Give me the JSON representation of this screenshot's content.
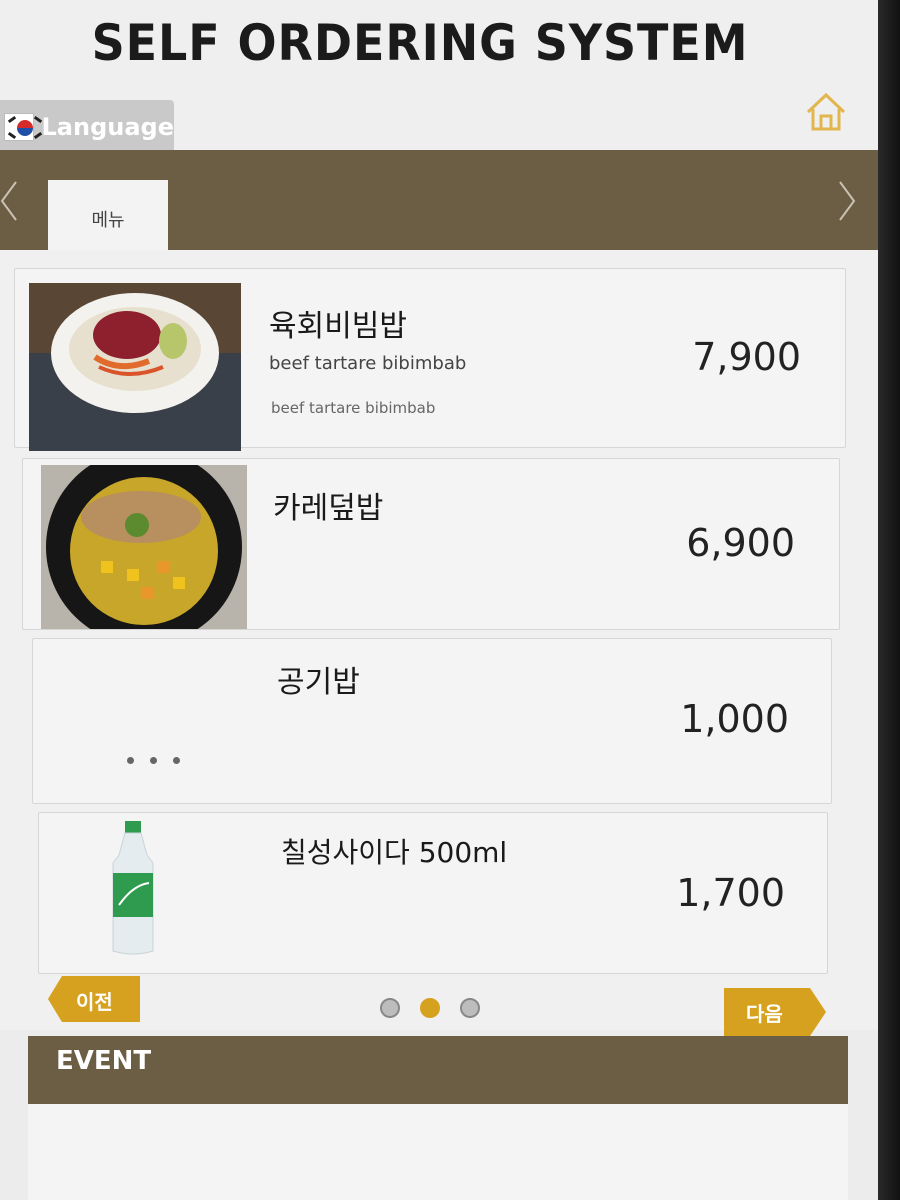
{
  "header": {
    "title": "SELF ORDERING SYSTEM",
    "language_label": "Language",
    "language_flag": "korea-flag",
    "home_icon": "home-icon"
  },
  "tabs": [
    {
      "label": "메뉴",
      "active": true
    }
  ],
  "menu_items": [
    {
      "name": "육회비빔밥",
      "subtitle": "beef tartare bibimbab",
      "description": "beef tartare bibimbab",
      "price": "7,900",
      "image": "beef-tartare-bibimbab"
    },
    {
      "name": "카레덮밥",
      "subtitle": "",
      "description": "",
      "price": "6,900",
      "image": "curry-rice-bowl"
    },
    {
      "name": "공기밥",
      "subtitle": "",
      "description": "",
      "price": "1,000",
      "image": "no-image"
    },
    {
      "name": "칠성사이다 500ml",
      "subtitle": "",
      "description": "",
      "price": "1,700",
      "image": "chilsung-cider-bottle"
    }
  ],
  "navigation": {
    "prev_label": "이전",
    "next_label": "다음",
    "pages": 3,
    "current_page": 2
  },
  "event": {
    "label": "EVENT"
  },
  "colors": {
    "brand_bar": "#6b5e45",
    "accent": "#d6a11e",
    "background": "#ececec"
  }
}
